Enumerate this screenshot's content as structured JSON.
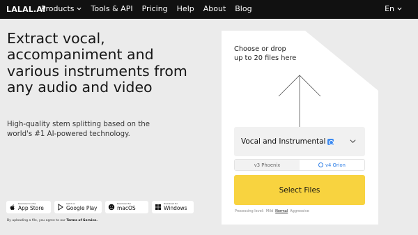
{
  "nav": {
    "logo": "LALAL.AI",
    "items": [
      {
        "label": "Products",
        "dropdown": true
      },
      {
        "label": "Tools & API",
        "dropdown": false
      },
      {
        "label": "Pricing",
        "dropdown": false
      },
      {
        "label": "Help",
        "dropdown": false
      },
      {
        "label": "About",
        "dropdown": false
      },
      {
        "label": "Blog",
        "dropdown": false
      }
    ],
    "language": "En"
  },
  "hero": {
    "headline": "Extract vocal, accompaniment and various instruments from any audio and video",
    "subhead": "High-quality stem splitting based on the world's #1 AI-powered technology."
  },
  "stores": [
    {
      "small": "Download on the",
      "label": "App Store",
      "icon": "apple-icon"
    },
    {
      "small": "Get it on",
      "label": "Google Play",
      "icon": "google-play-icon"
    },
    {
      "small": "Download for",
      "label": "macOS",
      "icon": "macos-icon"
    },
    {
      "small": "Download for",
      "label": "Windows",
      "icon": "windows-icon"
    }
  ],
  "tos": {
    "text": "By uploading a file, you agree to our ",
    "link": "Terms of Service."
  },
  "upload": {
    "drop_text": "Choose or drop up to 20 files here",
    "stem_option": "Vocal and Instrumental",
    "versions": [
      {
        "label": "v3 Phoenix",
        "selected": false
      },
      {
        "label": "v4 Orion",
        "selected": true
      }
    ],
    "select_button": "Select Files",
    "processing_label": "Processing level:",
    "levels": [
      {
        "label": "Mild",
        "active": false
      },
      {
        "label": "Normal",
        "active": true
      },
      {
        "label": "Aggressive",
        "active": false
      }
    ]
  },
  "colors": {
    "nav_bg": "#111111",
    "accent_yellow": "#f8d33f",
    "accent_blue": "#2f7fe6",
    "page_bg": "#ebebeb"
  }
}
